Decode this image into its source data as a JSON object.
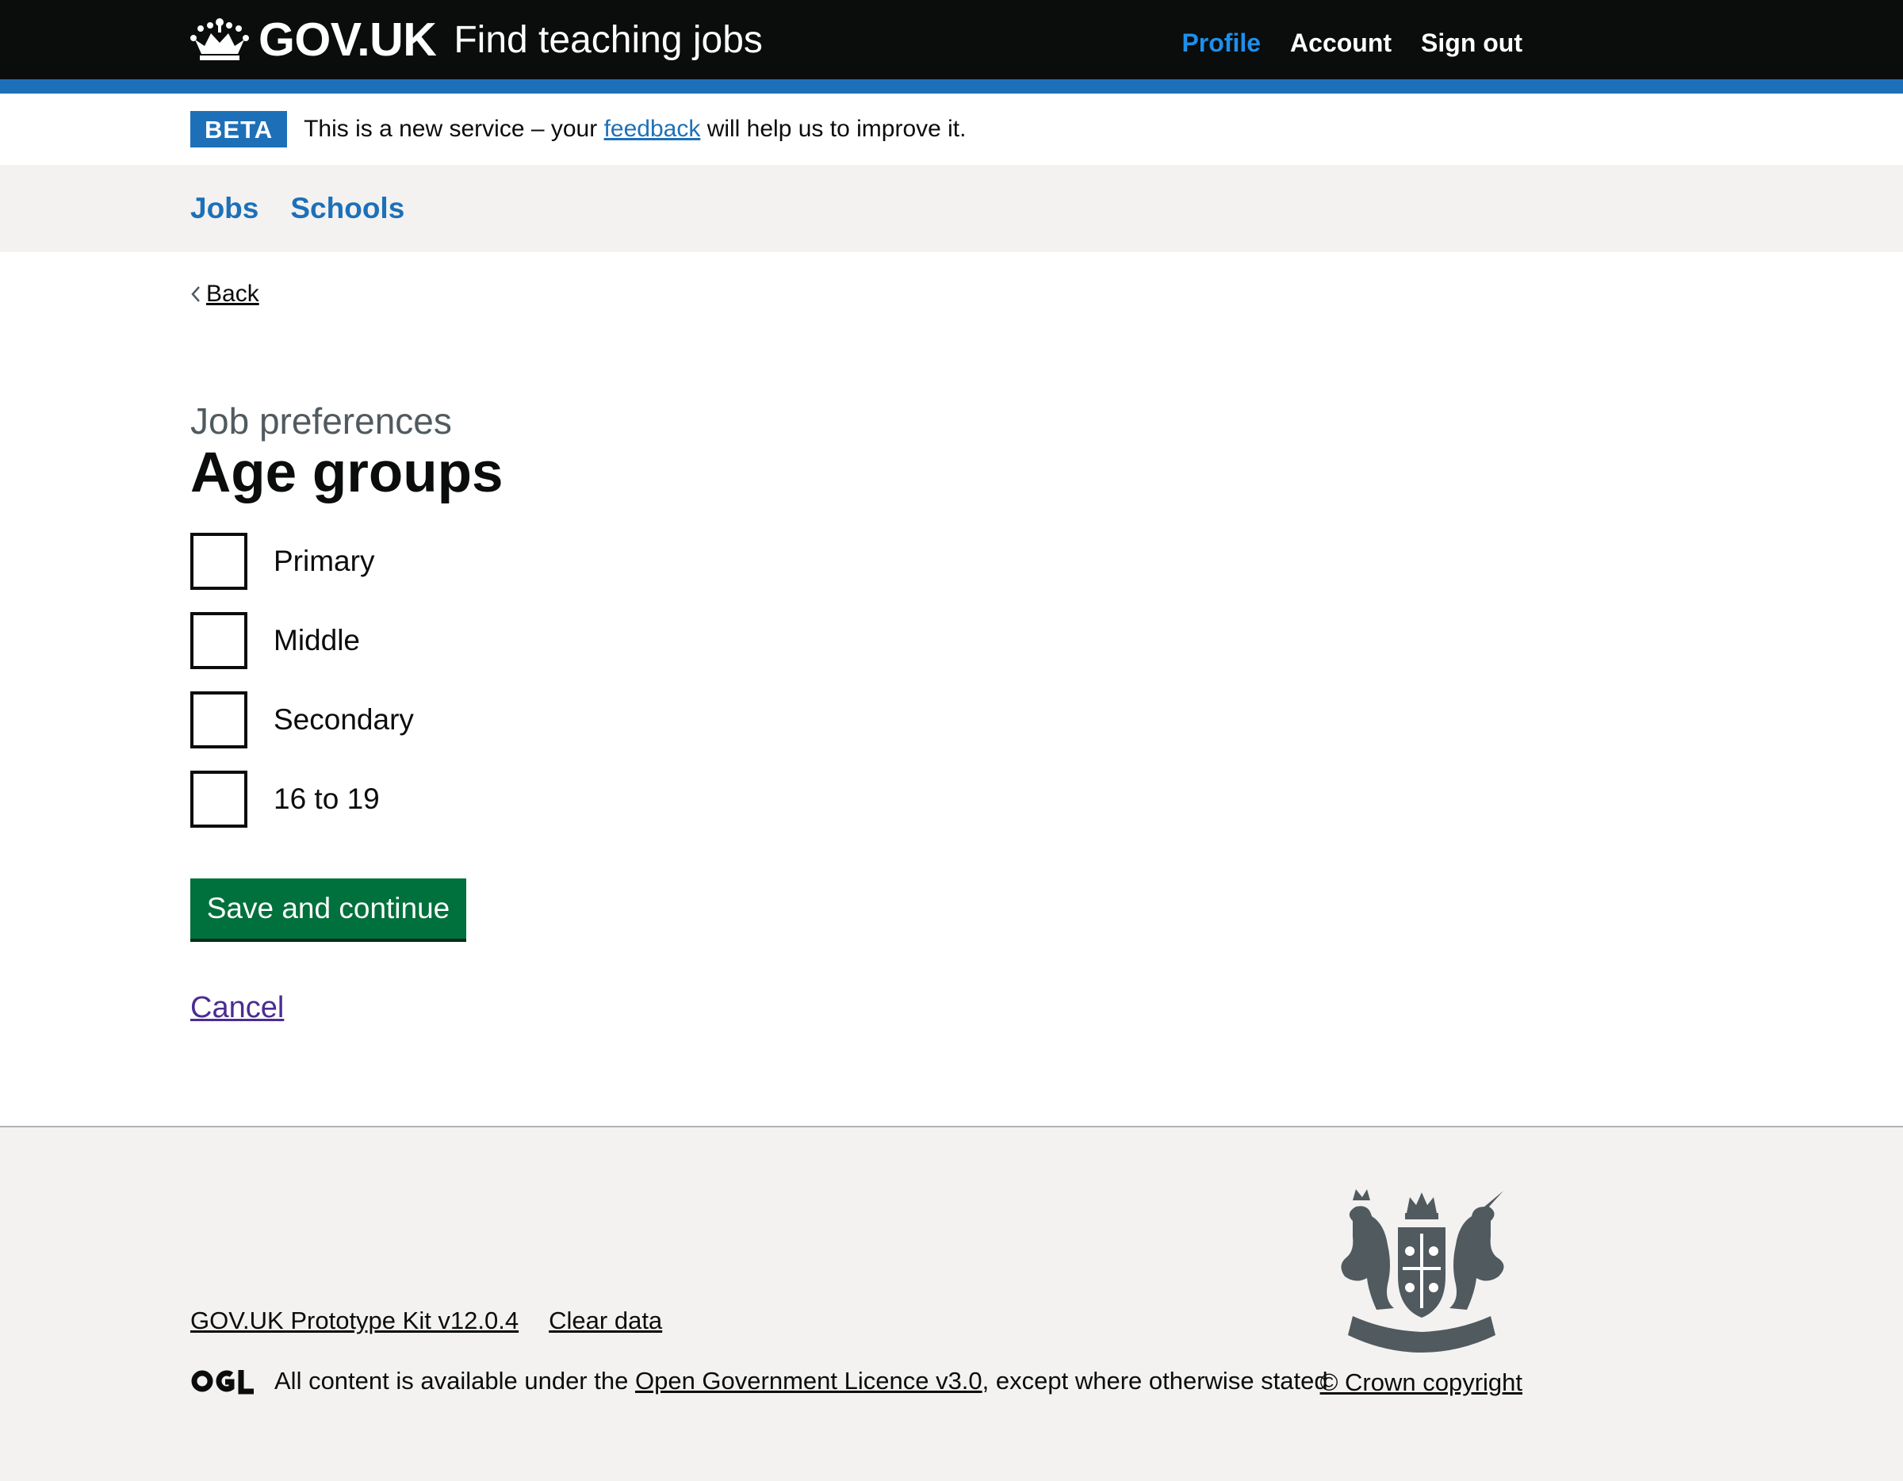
{
  "header": {
    "logotype": "GOV.UK",
    "service_name": "Find teaching jobs",
    "nav": {
      "profile": "Profile",
      "account": "Account",
      "sign_out": "Sign out"
    },
    "active_color": "#1d8feb"
  },
  "phase_banner": {
    "tag": "BETA",
    "text_before": "This is a new service – your",
    "link": "feedback",
    "text_after": "will help us to improve it."
  },
  "subnav": {
    "jobs": "Jobs",
    "schools": "Schools"
  },
  "main": {
    "back_label": "Back",
    "caption": "Job preferences",
    "title": "Age groups",
    "options": [
      {
        "label": "Primary",
        "checked": false
      },
      {
        "label": "Middle",
        "checked": false
      },
      {
        "label": "Secondary",
        "checked": false
      },
      {
        "label": "16 to 19",
        "checked": false
      }
    ],
    "submit_label": "Save and continue",
    "cancel_label": "Cancel",
    "button_color": "#00703c"
  },
  "footer": {
    "prototype_kit": "GOV.UK Prototype Kit v12.0.4",
    "clear_data": "Clear data",
    "licence_before": "All content is available under the",
    "licence_link": "Open Government Licence v3.0",
    "licence_after": ", except where otherwise stated",
    "copyright": "© Crown copyright"
  }
}
